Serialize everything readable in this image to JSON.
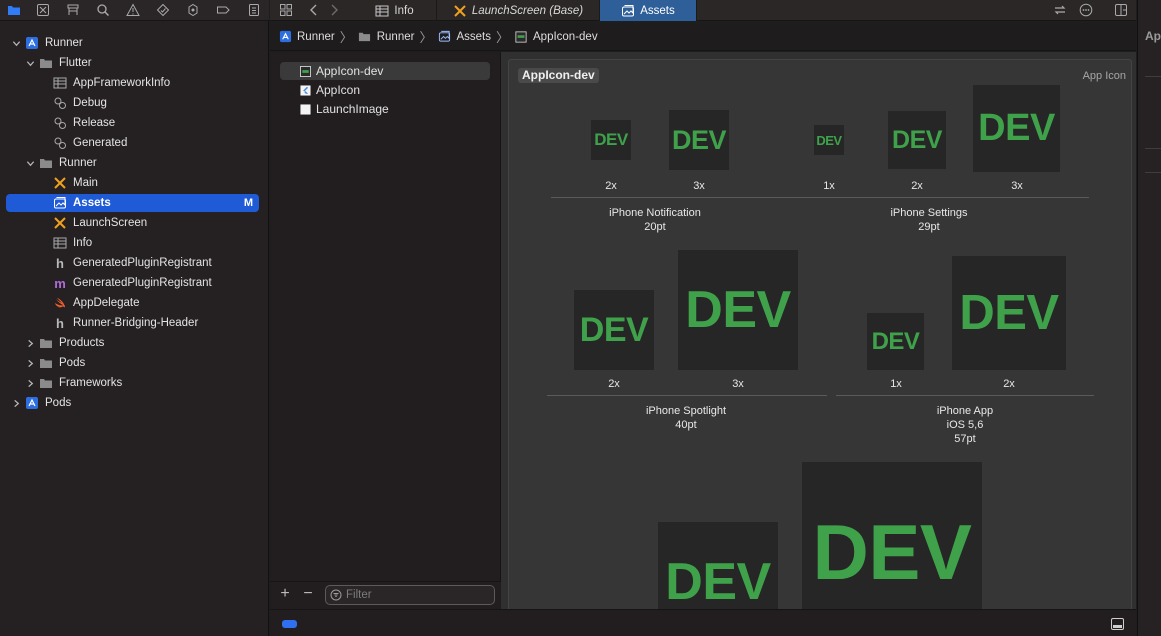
{
  "navigator": {
    "toolbar_icons": [
      "folder-icon",
      "source-control-icon",
      "symbol-icon",
      "find-icon",
      "issue-icon",
      "test-icon",
      "debug-icon",
      "breakpoint-icon",
      "report-icon"
    ],
    "tree": [
      {
        "label": "Runner",
        "icon": "xcode-project-icon",
        "expanded": true
      },
      {
        "label": "Flutter",
        "icon": "folder-icon",
        "expanded": true
      },
      {
        "label": "AppFrameworkInfo",
        "icon": "plist-icon"
      },
      {
        "label": "Debug",
        "icon": "xcconfig-icon"
      },
      {
        "label": "Release",
        "icon": "xcconfig-icon"
      },
      {
        "label": "Generated",
        "icon": "xcconfig-icon"
      },
      {
        "label": "Runner",
        "icon": "folder-icon",
        "expanded": true
      },
      {
        "label": "Main",
        "icon": "storyboard-icon"
      },
      {
        "label": "Assets",
        "icon": "asset-catalog-icon",
        "badge": "M",
        "selected": true
      },
      {
        "label": "LaunchScreen",
        "icon": "storyboard-icon"
      },
      {
        "label": "Info",
        "icon": "plist-icon"
      },
      {
        "label": "GeneratedPluginRegistrant",
        "icon": "header-icon"
      },
      {
        "label": "GeneratedPluginRegistrant",
        "icon": "objc-icon"
      },
      {
        "label": "AppDelegate",
        "icon": "swift-icon"
      },
      {
        "label": "Runner-Bridging-Header",
        "icon": "header-icon"
      },
      {
        "label": "Products",
        "icon": "folder-icon",
        "expanded": false
      },
      {
        "label": "Pods",
        "icon": "folder-icon",
        "expanded": false
      },
      {
        "label": "Frameworks",
        "icon": "folder-icon",
        "expanded": false
      },
      {
        "label": "Pods",
        "icon": "xcode-project-icon",
        "expanded": false
      }
    ]
  },
  "tabs": [
    {
      "label": "Info",
      "icon": "plist-icon",
      "active": false,
      "italic": false
    },
    {
      "label": "LaunchScreen (Base)",
      "icon": "storyboard-icon",
      "active": false,
      "italic": true
    },
    {
      "label": "Assets",
      "icon": "asset-catalog-icon",
      "active": true,
      "italic": false
    }
  ],
  "breadcrumb": [
    {
      "label": "Runner",
      "icon": "xcode-project-icon"
    },
    {
      "label": "Runner",
      "icon": "folder-icon"
    },
    {
      "label": "Assets",
      "icon": "asset-catalog-icon"
    },
    {
      "label": "AppIcon-dev",
      "icon": "appicon-set-icon"
    }
  ],
  "asset_list": {
    "items": [
      {
        "label": "AppIcon-dev",
        "icon": "appicon-set-icon",
        "selected": true
      },
      {
        "label": "AppIcon",
        "icon": "flutter-appicon-icon",
        "selected": false
      },
      {
        "label": "LaunchImage",
        "icon": "imageset-icon",
        "selected": false
      }
    ],
    "filter_placeholder": "Filter"
  },
  "editor": {
    "iconset_name": "AppIcon-dev",
    "iconset_type": "App Icon",
    "icon_text": "DEV",
    "groups": [
      {
        "title": "iPhone Notification",
        "size": "20pt",
        "scales": [
          "2x",
          "3x"
        ]
      },
      {
        "title": "iPhone Settings",
        "size": "29pt",
        "scales": [
          "1x",
          "2x",
          "3x"
        ]
      },
      {
        "title": "iPhone Spotlight",
        "size": "40pt",
        "scales": [
          "2x",
          "3x"
        ]
      },
      {
        "title": "iPhone App",
        "subtitle": "iOS 5,6",
        "size": "57pt",
        "scales": [
          "1x",
          "2x"
        ]
      }
    ]
  },
  "inspector": {
    "title": "Ap"
  },
  "colors": {
    "accent": "#1f5bd6",
    "icon_green": "#3fa24b",
    "active_tab": "#2f5f98"
  }
}
